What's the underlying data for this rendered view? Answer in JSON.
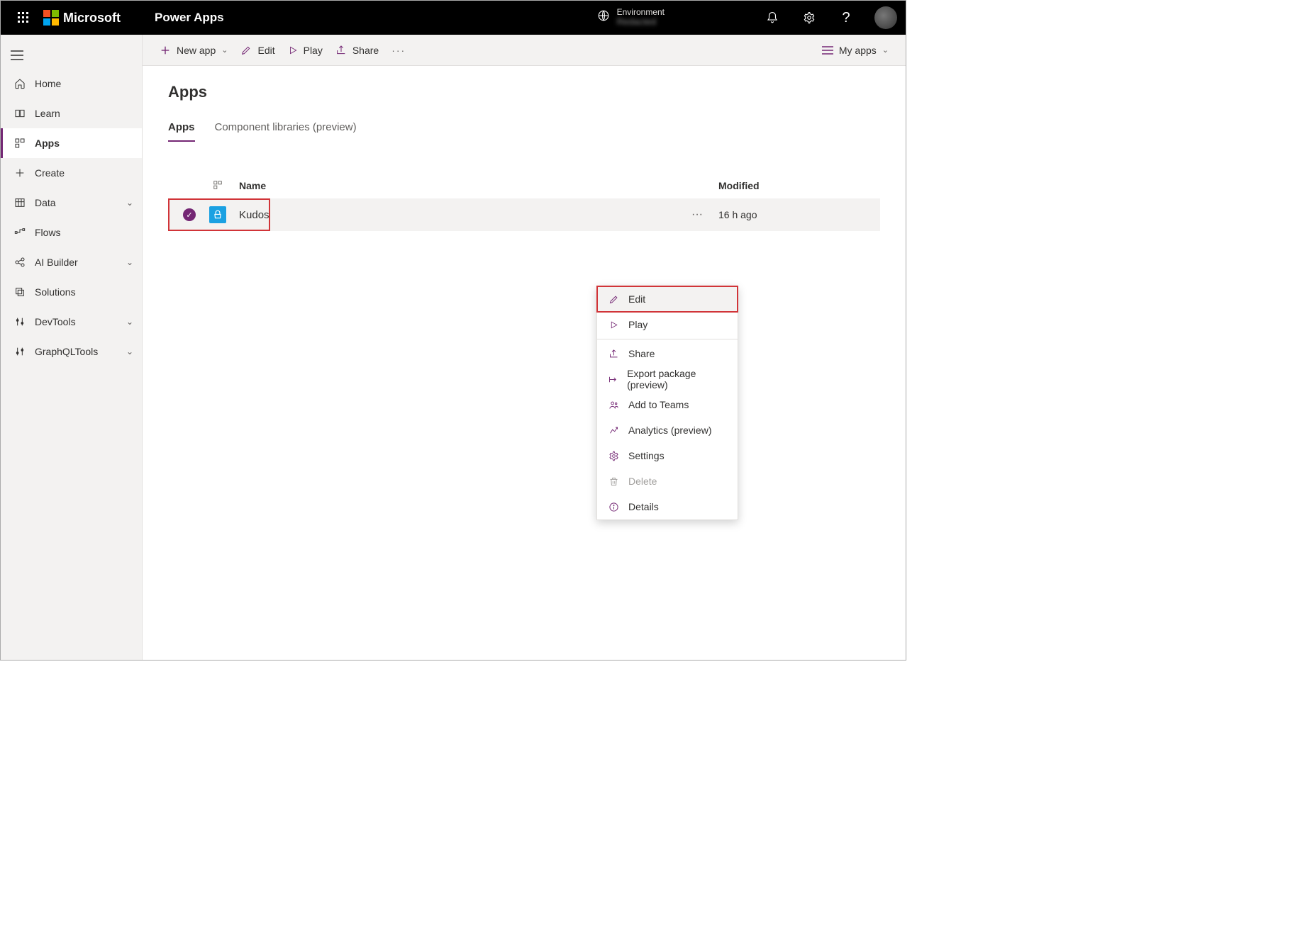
{
  "header": {
    "brand": "Microsoft",
    "product": "Power Apps",
    "environment_label": "Environment",
    "environment_value": "Redacted"
  },
  "sidebar": {
    "items": [
      {
        "icon": "home-icon",
        "label": "Home",
        "expandable": false
      },
      {
        "icon": "book-icon",
        "label": "Learn",
        "expandable": false
      },
      {
        "icon": "apps-icon",
        "label": "Apps",
        "expandable": false,
        "active": true
      },
      {
        "icon": "plus-icon",
        "label": "Create",
        "expandable": false
      },
      {
        "icon": "table-icon",
        "label": "Data",
        "expandable": true
      },
      {
        "icon": "flow-icon",
        "label": "Flows",
        "expandable": false
      },
      {
        "icon": "ai-icon",
        "label": "AI Builder",
        "expandable": true
      },
      {
        "icon": "solution-icon",
        "label": "Solutions",
        "expandable": false
      },
      {
        "icon": "devtools-icon",
        "label": "DevTools",
        "expandable": true
      },
      {
        "icon": "graphql-icon",
        "label": "GraphQLTools",
        "expandable": true
      }
    ]
  },
  "commandbar": {
    "new_app": "New app",
    "edit": "Edit",
    "play": "Play",
    "share": "Share",
    "view_selector": "My apps"
  },
  "page": {
    "title": "Apps",
    "tabs": {
      "apps": "Apps",
      "component_libs": "Component libraries (preview)"
    },
    "columns": {
      "name": "Name",
      "modified": "Modified"
    },
    "rows": [
      {
        "selected": true,
        "name": "Kudos",
        "modified": "16 h ago"
      }
    ]
  },
  "context_menu": {
    "edit": "Edit",
    "play": "Play",
    "share": "Share",
    "export": "Export package (preview)",
    "add_teams": "Add to Teams",
    "analytics": "Analytics (preview)",
    "settings": "Settings",
    "delete": "Delete",
    "details": "Details"
  }
}
